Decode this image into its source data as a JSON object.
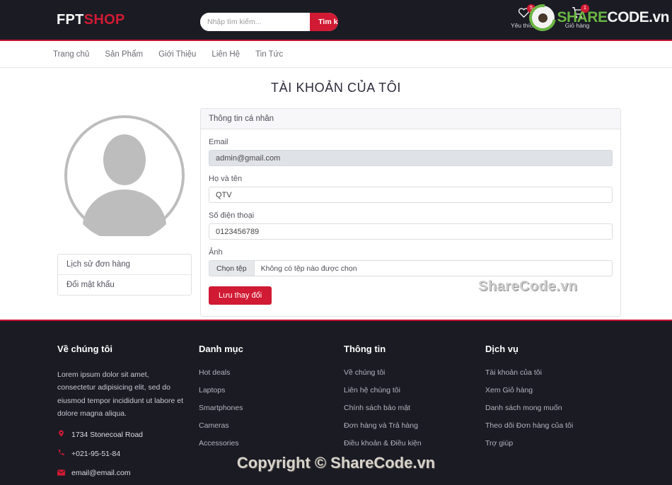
{
  "header": {
    "brand_fpt": "FPT",
    "brand_shop": "SHOP",
    "search_placeholder": "Nhập tìm kiếm...",
    "search_value": "",
    "search_button": "Tìm kiếm",
    "wishlist_label": "Yêu thích",
    "wishlist_count": "5",
    "cart_label": "Giỏ hàng",
    "cart_count": "1"
  },
  "watermark": {
    "logo_part1": "SHARE",
    "logo_part2": "CODE",
    "logo_part3": ".vn",
    "inline": "ShareCode.vn",
    "copyright": "Copyright © ShareCode.vn"
  },
  "nav": {
    "items": [
      {
        "label": "Trang chủ"
      },
      {
        "label": "Sản Phẩm"
      },
      {
        "label": "Giới Thiệu"
      },
      {
        "label": "Liên Hệ"
      },
      {
        "label": "Tin Tức"
      }
    ]
  },
  "page": {
    "title": "TÀI KHOẢN CỦA TÔI"
  },
  "sidebar": {
    "menu": [
      {
        "label": "Lịch sử đơn hàng"
      },
      {
        "label": "Đổi mật khẩu"
      }
    ]
  },
  "form": {
    "card_title": "Thông tin cá nhân",
    "email_label": "Email",
    "email_value": "admin@gmail.com",
    "fullname_label": "Họ và tên",
    "fullname_value": "QTV",
    "phone_label": "Số điện thoại",
    "phone_value": "0123456789",
    "photo_label": "Ảnh",
    "file_button": "Chọn tệp",
    "file_status": "Không có tệp nào được chọn",
    "save_button": "Lưu thay đổi"
  },
  "footer": {
    "col_about": {
      "title": "Về chúng tôi",
      "text": "Lorem ipsum dolor sit amet, consectetur adipisicing elit, sed do eiusmod tempor incididunt ut labore et dolore magna aliqua.",
      "address": "1734 Stonecoal Road",
      "phone": "+021-95-51-84",
      "email": "email@email.com"
    },
    "col_category": {
      "title": "Danh mục",
      "links": [
        {
          "label": "Hot deals"
        },
        {
          "label": "Laptops"
        },
        {
          "label": "Smartphones"
        },
        {
          "label": "Cameras"
        },
        {
          "label": "Accessories"
        }
      ]
    },
    "col_info": {
      "title": "Thông tin",
      "links": [
        {
          "label": "Về chúng tôi"
        },
        {
          "label": "Liên hệ chúng tôi"
        },
        {
          "label": "Chính sách bảo mật"
        },
        {
          "label": "Đơn hàng và Trả hàng"
        },
        {
          "label": "Điều khoản & Điều kiện"
        }
      ]
    },
    "col_service": {
      "title": "Dịch vụ",
      "links": [
        {
          "label": "Tài khoản của tôi"
        },
        {
          "label": "Xem Giỏ hàng"
        },
        {
          "label": "Danh sách mong muốn"
        },
        {
          "label": "Theo dõi Đơn hàng của tôi"
        },
        {
          "label": "Trợ giúp"
        }
      ]
    }
  },
  "colors": {
    "accent_red": "#d11a33",
    "dark_bg": "#1b1b24",
    "logo_green": "#6fbe44"
  }
}
